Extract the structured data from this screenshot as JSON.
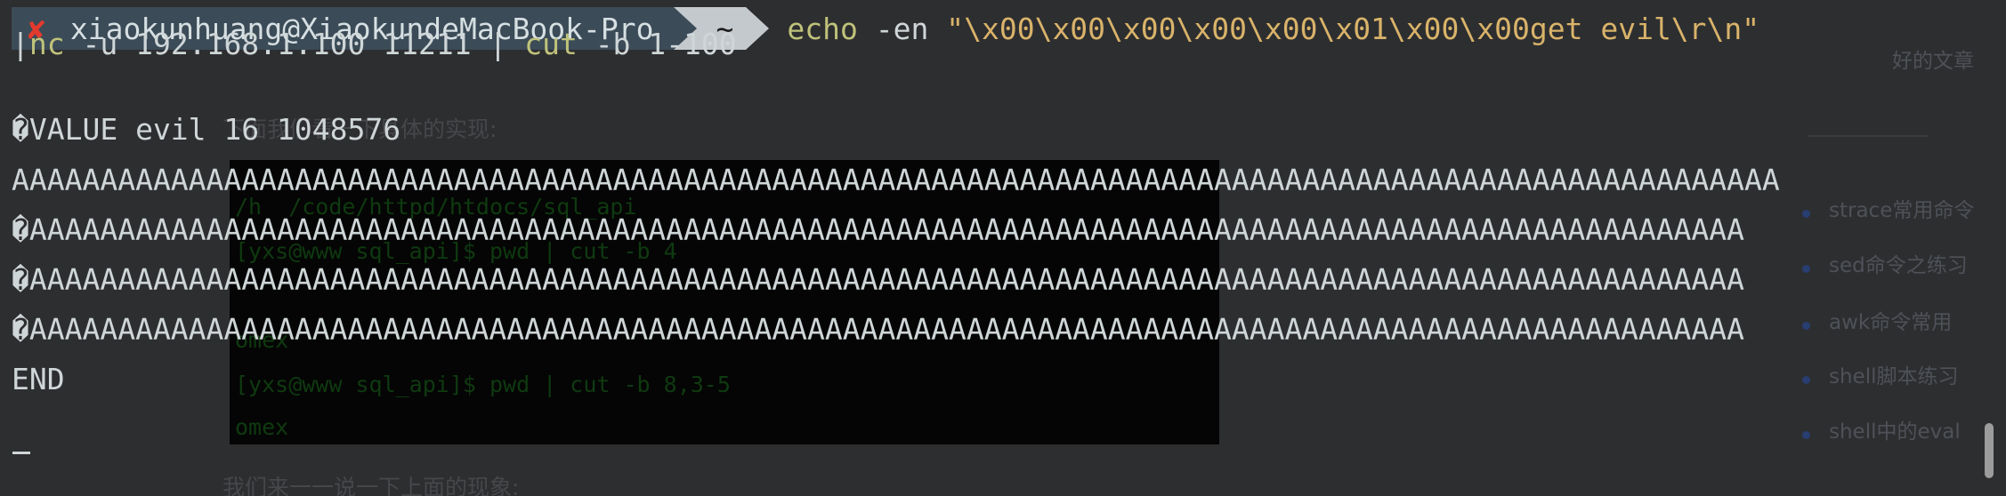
{
  "prompt": {
    "status_glyph": "✘",
    "user_host": "xiaokunhuang@XiaokundeMacBook-Pro",
    "dir": "~"
  },
  "command": {
    "echo": "echo",
    "flag": "-en",
    "string": "\"\\x00\\x00\\x00\\x00\\x00\\x01\\x00\\x00get evil\\r\\n\"",
    "pipe1": "|",
    "nc": "nc",
    "nc_args": "-u 192.168.1.100 11211 | ",
    "cut": "cut",
    "cut_args": "-b 1-100"
  },
  "output": [
    "�VALUE evil 16 1048576",
    "AAAAAAAAAAAAAAAAAAAAAAAAAAAAAAAAAAAAAAAAAAAAAAAAAAAAAAAAAAAAAAAAAAAAAAAAAAAAAAAAAAAAAAAAAAAAAAAAAAAA",
    "�AAAAAAAAAAAAAAAAAAAAAAAAAAAAAAAAAAAAAAAAAAAAAAAAAAAAAAAAAAAAAAAAAAAAAAAAAAAAAAAAAAAAAAAAAAAAAAAAA",
    "�AAAAAAAAAAAAAAAAAAAAAAAAAAAAAAAAAAAAAAAAAAAAAAAAAAAAAAAAAAAAAAAAAAAAAAAAAAAAAAAAAAAAAAAAAAAAAAAAA",
    "�AAAAAAAAAAAAAAAAAAAAAAAAAAAAAAAAAAAAAAAAAAAAAAAAAAAAAAAAAAAAAAAAAAAAAAAAAAAAAAAAAAAAAAAAAAAAAAAAA",
    "END"
  ],
  "background": {
    "blog_text_top": "下面我们看一下具体的实现:",
    "blog_text_bottom": "我们来一一说一下上面的现象:",
    "screenshot_lines": [
      "/h  /code/httpd/htdocs/sql_api",
      "[yxs@www sql_api]$ pwd | cut -b 4",
      "",
      "omex",
      "[yxs@www sql_api]$ pwd | cut -b 8,3-5",
      "omex"
    ],
    "side_header": "好的文章",
    "side_items": [
      "strace常用命令",
      "sed命令之练习",
      "awk命令常用",
      "shell脚本练习",
      "shell中的eval"
    ]
  },
  "colors": {
    "terminal_bg": "#2d2e30",
    "text": "#cfd6d8",
    "command": "#bfc27a",
    "string": "#d9b36a",
    "error_mark": "#e23a2e"
  }
}
